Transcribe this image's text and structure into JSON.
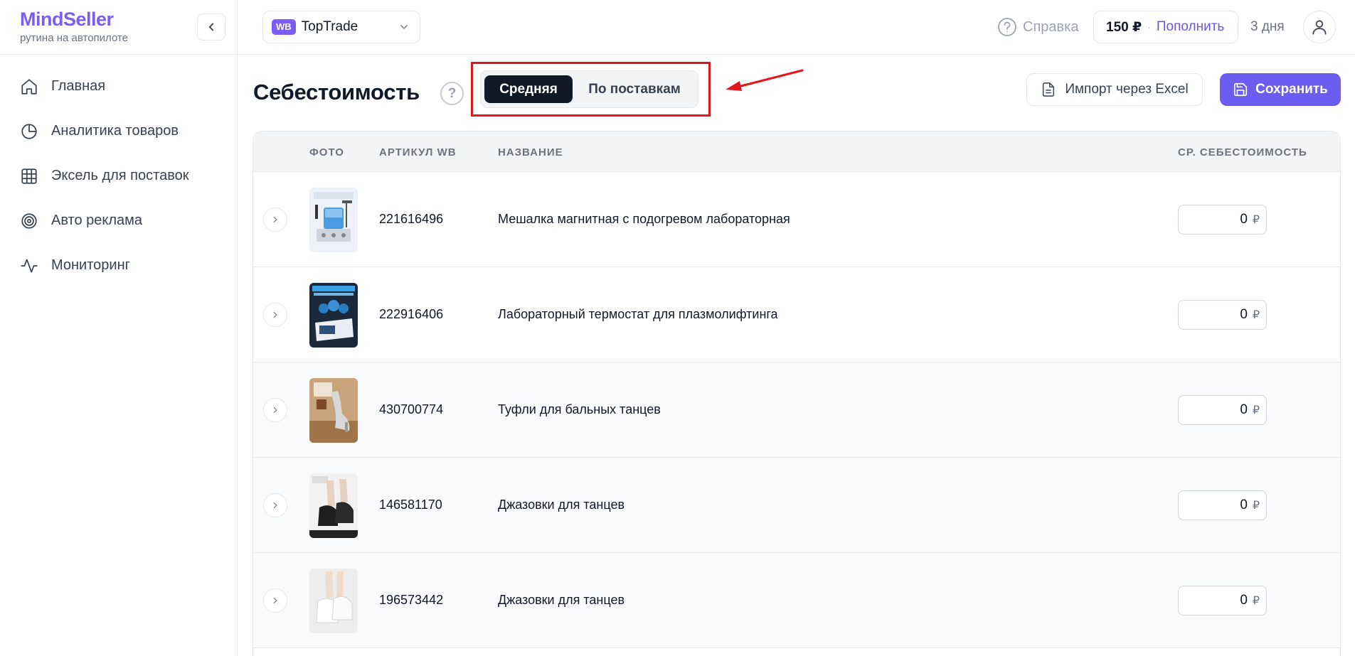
{
  "brand": {
    "name": "MindSeller",
    "tagline": "рутина на автопилоте"
  },
  "sidebar": {
    "items": [
      {
        "label": "Главная",
        "icon": "home-icon"
      },
      {
        "label": "Аналитика товаров",
        "icon": "pie-chart-icon"
      },
      {
        "label": "Эксель для поставок",
        "icon": "grid-icon"
      },
      {
        "label": "Авто реклама",
        "icon": "target-icon"
      },
      {
        "label": "Мониторинг",
        "icon": "activity-icon"
      }
    ]
  },
  "topbar": {
    "store_badge": "WB",
    "store_name": "TopTrade",
    "help_label": "Справка",
    "balance": "150 ₽",
    "balance_separator": "·",
    "topup_label": "Пополнить",
    "days_left": "3 дня"
  },
  "page": {
    "title": "Себестоимость",
    "help_mark": "?",
    "modes": {
      "active": "Средняя",
      "inactive": "По поставкам"
    },
    "import_label": "Импорт через Excel",
    "save_label": "Сохранить"
  },
  "table": {
    "columns": {
      "photo": "ФОТО",
      "sku": "АРТИКУЛ WB",
      "name": "НАЗВАНИЕ",
      "cost": "СР. СЕБЕСТОИМОСТЬ"
    },
    "currency": "₽",
    "rows": [
      {
        "sku": "221616496",
        "name": "Мешалка магнитная с подогревом лабораторная",
        "cost": "0"
      },
      {
        "sku": "222916406",
        "name": "Лабораторный термостат для плазмолифтинга",
        "cost": "0"
      },
      {
        "sku": "430700774",
        "name": "Туфли для бальных танцев",
        "cost": "0"
      },
      {
        "sku": "146581170",
        "name": "Джазовки для танцев",
        "cost": "0"
      },
      {
        "sku": "196573442",
        "name": "Джазовки для танцев",
        "cost": "0"
      }
    ]
  },
  "colors": {
    "brand": "#7b5cf5",
    "primary_button": "#6d5cf0",
    "active_toggle": "#111827",
    "annotation_red": "#e3171b"
  }
}
